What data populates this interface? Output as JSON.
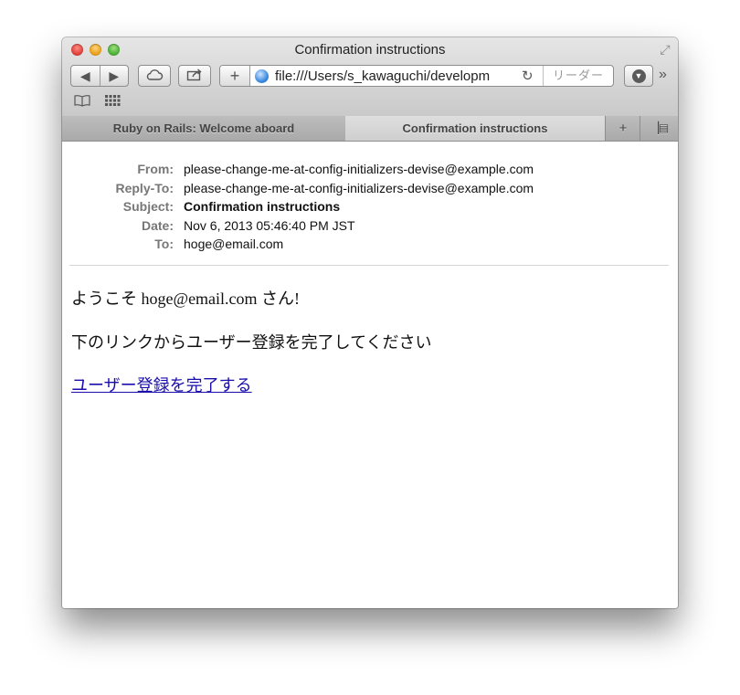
{
  "window": {
    "title": "Confirmation instructions"
  },
  "toolbar": {
    "back_icon": "back-arrow-icon",
    "forward_icon": "forward-arrow-icon",
    "address": "file:///Users/s_kawaguchi/developm",
    "reader_label": "リーダー"
  },
  "tabs": [
    {
      "label": "Ruby on Rails: Welcome aboard",
      "active": false
    },
    {
      "label": "Confirmation instructions",
      "active": true
    }
  ],
  "email": {
    "headers": [
      {
        "label": "From:",
        "value": "please-change-me-at-config-initializers-devise@example.com"
      },
      {
        "label": "Reply-To:",
        "value": "please-change-me-at-config-initializers-devise@example.com"
      },
      {
        "label": "Subject:",
        "value": "Confirmation instructions"
      },
      {
        "label": "Date:",
        "value": "Nov 6, 2013 05:46:40 PM JST"
      },
      {
        "label": "To:",
        "value": "hoge@email.com"
      }
    ],
    "greeting": "ようこそ hoge@email.com さん!",
    "instruction": "下のリンクからユーザー登録を完了してください",
    "link_text": "ユーザー登録を完了する"
  },
  "colors": {
    "link": "#1a0dab",
    "close": "#e0443e",
    "minimize": "#e9a21f",
    "maximize": "#4fb33a"
  }
}
